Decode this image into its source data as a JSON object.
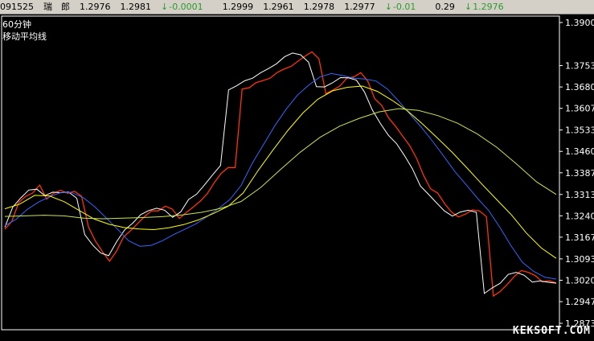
{
  "topbar": {
    "code": "091525",
    "name": "瑞　郎",
    "open": "1.2976",
    "high": "1.2981",
    "change": "-0.0001",
    "v4": "1.2999",
    "v5": "1.2961",
    "v6": "1.2978",
    "v7": "1.2977",
    "change2": "-0.01",
    "v9": "0.29",
    "last": "1.2976"
  },
  "chart_title": "60分钟",
  "indicator_label": "移动平均线",
  "watermark": "KEKSOFT.COM",
  "colors": {
    "background": "#000000",
    "axis": "#ffffff",
    "up_candle": "#ff3300",
    "down_candle": "#00ff00",
    "ma_short": "#ffffff",
    "ma_mid": "#ffff00",
    "ma_blue": "#3366ff",
    "ma_long": "#c8e650",
    "down_arrow": "#2e9a2e"
  },
  "chart_data": {
    "type": "line",
    "title": "60分钟",
    "ylim": [
      1.2873,
      1.39
    ],
    "y_ticks": [
      "1.3900",
      "1.3753",
      "1.3680",
      "1.3607",
      "1.3533",
      "1.3460",
      "1.3387",
      "1.3313",
      "1.3240",
      "1.3167",
      "1.3093",
      "1.3020",
      "1.2947",
      "1.2873"
    ],
    "n": 100,
    "series": [
      {
        "color": "#ff3300",
        "values": [
          1.3194,
          1.3221,
          1.3286,
          1.3307,
          1.3318,
          1.3345,
          1.3297,
          1.3317,
          1.3327,
          1.3317,
          1.3324,
          1.3307,
          1.3201,
          1.3153,
          1.3117,
          1.3085,
          1.3119,
          1.3167,
          1.3189,
          1.3213,
          1.3237,
          1.3257,
          1.3257,
          1.3273,
          1.3263,
          1.3231,
          1.3251,
          1.327,
          1.329,
          1.3315,
          1.3353,
          1.3385,
          1.3405,
          1.3405,
          1.3673,
          1.3677,
          1.3695,
          1.3702,
          1.371,
          1.3729,
          1.3741,
          1.375,
          1.3768,
          1.3785,
          1.38,
          1.3776,
          1.3657,
          1.3669,
          1.3683,
          1.371,
          1.3714,
          1.3729,
          1.37,
          1.364,
          1.3617,
          1.3574,
          1.3545,
          1.3512,
          1.348,
          1.3436,
          1.3378,
          1.3332,
          1.3318,
          1.3282,
          1.3253,
          1.3236,
          1.3246,
          1.326,
          1.3257,
          1.3237,
          1.2966,
          1.2982,
          1.3006,
          1.3033,
          1.3053,
          1.3047,
          1.3036,
          1.3015,
          1.3018,
          1.3011
        ]
      },
      {
        "color": "#ffffff",
        "values": [
          1.3201,
          1.327,
          1.3301,
          1.3328,
          1.3331,
          1.3309,
          1.3321,
          1.3319,
          1.3321,
          1.33,
          1.3176,
          1.314,
          1.3113,
          1.3104,
          1.3152,
          1.3192,
          1.3215,
          1.3244,
          1.3258,
          1.3266,
          1.3259,
          1.3235,
          1.3253,
          1.3296,
          1.3314,
          1.3346,
          1.338,
          1.3412,
          1.367,
          1.3684,
          1.3701,
          1.371,
          1.3728,
          1.3743,
          1.3759,
          1.3783,
          1.3796,
          1.379,
          1.3765,
          1.3681,
          1.368,
          1.3694,
          1.3712,
          1.3711,
          1.3703,
          1.3663,
          1.3601,
          1.3555,
          1.3515,
          1.3487,
          1.3446,
          1.3401,
          1.3342,
          1.3314,
          1.3285,
          1.3257,
          1.3239,
          1.3253,
          1.3259,
          1.3252,
          1.2975,
          1.2994,
          1.301,
          1.304,
          1.3047,
          1.3037,
          1.3014,
          1.3018,
          1.3013,
          1.301
        ]
      },
      {
        "color": "#3366ff",
        "values": [
          1.3206,
          1.3228,
          1.3262,
          1.3287,
          1.3305,
          1.332,
          1.3319,
          1.3301,
          1.3271,
          1.3233,
          1.3195,
          1.3155,
          1.3136,
          1.3139,
          1.3155,
          1.3176,
          1.3194,
          1.3213,
          1.3238,
          1.3265,
          1.3296,
          1.3344,
          1.342,
          1.3484,
          1.3548,
          1.3604,
          1.3652,
          1.3686,
          1.3714,
          1.3726,
          1.3719,
          1.371,
          1.3707,
          1.37,
          1.3673,
          1.3632,
          1.3587,
          1.3543,
          1.3495,
          1.3444,
          1.3391,
          1.3346,
          1.33,
          1.3258,
          1.32,
          1.3137,
          1.3081,
          1.305,
          1.303,
          1.3024
        ]
      },
      {
        "color": "#ffff00",
        "values": [
          1.3264,
          1.328,
          1.331,
          1.3308,
          1.3288,
          1.3258,
          1.3229,
          1.3211,
          1.32,
          1.3195,
          1.3193,
          1.3199,
          1.321,
          1.3226,
          1.3248,
          1.3273,
          1.3318,
          1.3395,
          1.3465,
          1.3532,
          1.3591,
          1.3638,
          1.3667,
          1.3679,
          1.3683,
          1.3665,
          1.3634,
          1.3599,
          1.3555,
          1.3507,
          1.3458,
          1.3404,
          1.3349,
          1.3296,
          1.3243,
          1.3181,
          1.313,
          1.3095
        ]
      },
      {
        "color": "#c8e650",
        "values": [
          1.3238,
          1.324,
          1.3242,
          1.324,
          1.3232,
          1.323,
          1.3232,
          1.3234,
          1.3237,
          1.3243,
          1.3252,
          1.3266,
          1.3289,
          1.3337,
          1.3398,
          1.3457,
          1.3508,
          1.3546,
          1.3573,
          1.3595,
          1.3606,
          1.36,
          1.3582,
          1.3556,
          1.3519,
          1.3473,
          1.3416,
          1.3356,
          1.3313
        ]
      }
    ]
  }
}
